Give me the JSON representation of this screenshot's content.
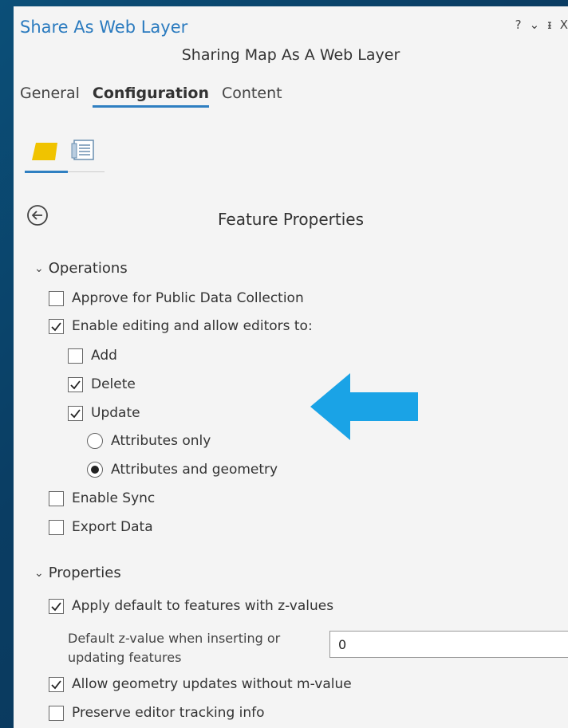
{
  "pane": {
    "title": "Share As Web Layer",
    "controls": [
      "?",
      "⌄",
      "ᵻ",
      "X"
    ],
    "subtitle": "Sharing Map As A Web Layer"
  },
  "tabs": [
    {
      "label": "General"
    },
    {
      "label": "Configuration",
      "active": true
    },
    {
      "label": "Content"
    }
  ],
  "icons": {
    "layer": "layer-icon",
    "list": "list-icon",
    "back": "back-arrow-icon",
    "pointer": "arrow-pointer-icon"
  },
  "section_title": "Feature Properties",
  "operations": {
    "header": "Operations",
    "approve_public": {
      "label": "Approve for Public Data Collection",
      "checked": false
    },
    "enable_editing": {
      "label": "Enable editing and allow editors to:",
      "checked": true
    },
    "add": {
      "label": "Add",
      "checked": false
    },
    "delete": {
      "label": "Delete",
      "checked": true
    },
    "update": {
      "label": "Update",
      "checked": true
    },
    "attributes_only": {
      "label": "Attributes only",
      "selected": false
    },
    "attributes_geometry": {
      "label": "Attributes and geometry",
      "selected": true
    },
    "enable_sync": {
      "label": "Enable Sync",
      "checked": false
    },
    "export_data": {
      "label": "Export Data",
      "checked": false
    }
  },
  "properties": {
    "header": "Properties",
    "apply_default_z": {
      "label": "Apply default to features with z-values",
      "checked": true
    },
    "z_value_label_line1": "Default z-value when inserting or",
    "z_value_label_line2": "updating features",
    "z_value": "0",
    "allow_geometry_updates": {
      "label": "Allow geometry updates without m-value",
      "checked": true
    },
    "preserve_editor_tracking": {
      "label": "Preserve editor tracking info",
      "checked": false
    }
  },
  "colors": {
    "accent": "#2f7fc1",
    "arrow": "#1aa3e6",
    "layer_icon": "#f0c300"
  }
}
